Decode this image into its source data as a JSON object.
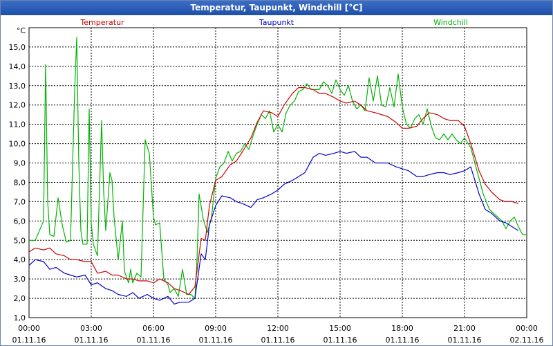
{
  "window": {
    "title": "Temperatur, Taupunkt, Windchill [°C]"
  },
  "colors": {
    "temperature": "#cc0000",
    "dewpoint": "#0000cc",
    "windchill": "#00b300",
    "titlebar": "#2a5bb8"
  },
  "chart_data": {
    "type": "line",
    "title": "Temperatur, Taupunkt, Windchill [°C]",
    "ylabel": "°C",
    "xlabel": "",
    "ylim": [
      1.0,
      16.0
    ],
    "xlim": [
      0,
      24
    ],
    "grid": true,
    "legend": "top",
    "y_ticks": [
      "1,0",
      "2,0",
      "3,0",
      "4,0",
      "5,0",
      "6,0",
      "7,0",
      "8,0",
      "9,0",
      "10,0",
      "11,0",
      "12,0",
      "13,0",
      "14,0",
      "15,0"
    ],
    "x_ticks": [
      {
        "time": "00:00",
        "date": "01.11.16"
      },
      {
        "time": "03:00",
        "date": "01.11.16"
      },
      {
        "time": "06:00",
        "date": "01.11.16"
      },
      {
        "time": "09:00",
        "date": "01.11.16"
      },
      {
        "time": "12:00",
        "date": "01.11.16"
      },
      {
        "time": "15:00",
        "date": "01.11.16"
      },
      {
        "time": "18:00",
        "date": "01.11.16"
      },
      {
        "time": "21:00",
        "date": "01.11.16"
      },
      {
        "time": "00:00",
        "date": "02.11.16"
      }
    ],
    "series": [
      {
        "name": "Temperatur",
        "color": "#cc0000",
        "points": [
          [
            0.0,
            4.4
          ],
          [
            0.3,
            4.6
          ],
          [
            0.7,
            4.5
          ],
          [
            1.0,
            4.6
          ],
          [
            1.3,
            4.3
          ],
          [
            1.7,
            4.2
          ],
          [
            2.0,
            4.0
          ],
          [
            2.3,
            4.0
          ],
          [
            2.7,
            3.9
          ],
          [
            3.0,
            3.9
          ],
          [
            3.3,
            3.3
          ],
          [
            3.7,
            3.4
          ],
          [
            4.0,
            3.2
          ],
          [
            4.3,
            3.2
          ],
          [
            4.7,
            3.0
          ],
          [
            5.0,
            3.0
          ],
          [
            5.3,
            2.9
          ],
          [
            5.7,
            2.9
          ],
          [
            6.0,
            2.8
          ],
          [
            6.3,
            3.0
          ],
          [
            6.7,
            2.8
          ],
          [
            7.0,
            2.5
          ],
          [
            7.3,
            2.4
          ],
          [
            7.7,
            2.2
          ],
          [
            8.0,
            2.6
          ],
          [
            8.3,
            5.1
          ],
          [
            8.5,
            5.0
          ],
          [
            8.7,
            6.8
          ],
          [
            9.0,
            8.1
          ],
          [
            9.3,
            8.3
          ],
          [
            9.7,
            8.9
          ],
          [
            10.0,
            9.1
          ],
          [
            10.3,
            9.6
          ],
          [
            10.7,
            10.3
          ],
          [
            11.0,
            11.1
          ],
          [
            11.3,
            11.7
          ],
          [
            11.7,
            11.6
          ],
          [
            12.0,
            11.4
          ],
          [
            12.3,
            12.0
          ],
          [
            12.7,
            12.6
          ],
          [
            13.0,
            12.9
          ],
          [
            13.3,
            12.9
          ],
          [
            13.7,
            12.8
          ],
          [
            14.0,
            12.6
          ],
          [
            14.3,
            12.6
          ],
          [
            14.7,
            12.4
          ],
          [
            15.0,
            12.2
          ],
          [
            15.3,
            12.1
          ],
          [
            15.7,
            12.2
          ],
          [
            16.0,
            12.0
          ],
          [
            16.3,
            11.7
          ],
          [
            16.7,
            11.6
          ],
          [
            17.0,
            11.5
          ],
          [
            17.3,
            11.4
          ],
          [
            17.7,
            11.1
          ],
          [
            18.0,
            10.8
          ],
          [
            18.3,
            10.8
          ],
          [
            18.7,
            10.9
          ],
          [
            19.0,
            11.3
          ],
          [
            19.3,
            11.6
          ],
          [
            19.7,
            11.5
          ],
          [
            20.0,
            11.3
          ],
          [
            20.3,
            11.2
          ],
          [
            20.7,
            11.2
          ],
          [
            21.0,
            10.9
          ],
          [
            21.3,
            10.0
          ],
          [
            21.7,
            8.6
          ],
          [
            22.0,
            7.9
          ],
          [
            22.3,
            7.5
          ],
          [
            22.7,
            7.1
          ],
          [
            23.0,
            7.0
          ],
          [
            23.3,
            7.0
          ],
          [
            23.6,
            6.9
          ]
        ]
      },
      {
        "name": "Taupunkt",
        "color": "#0000cc",
        "points": [
          [
            0.0,
            3.7
          ],
          [
            0.3,
            4.0
          ],
          [
            0.7,
            3.9
          ],
          [
            1.0,
            3.5
          ],
          [
            1.3,
            3.6
          ],
          [
            1.7,
            3.3
          ],
          [
            2.0,
            3.2
          ],
          [
            2.3,
            3.1
          ],
          [
            2.7,
            3.2
          ],
          [
            3.0,
            2.7
          ],
          [
            3.3,
            2.8
          ],
          [
            3.7,
            2.5
          ],
          [
            4.0,
            2.4
          ],
          [
            4.3,
            2.2
          ],
          [
            4.7,
            2.1
          ],
          [
            5.0,
            2.3
          ],
          [
            5.3,
            2.0
          ],
          [
            5.7,
            2.2
          ],
          [
            6.0,
            2.0
          ],
          [
            6.3,
            1.9
          ],
          [
            6.7,
            2.1
          ],
          [
            7.0,
            1.7
          ],
          [
            7.3,
            1.8
          ],
          [
            7.7,
            1.8
          ],
          [
            8.0,
            2.0
          ],
          [
            8.3,
            4.3
          ],
          [
            8.5,
            4.0
          ],
          [
            8.7,
            5.8
          ],
          [
            9.0,
            6.8
          ],
          [
            9.3,
            7.3
          ],
          [
            9.7,
            7.2
          ],
          [
            10.0,
            7.0
          ],
          [
            10.3,
            6.9
          ],
          [
            10.7,
            6.7
          ],
          [
            11.0,
            7.1
          ],
          [
            11.3,
            7.2
          ],
          [
            11.7,
            7.4
          ],
          [
            12.0,
            7.6
          ],
          [
            12.3,
            7.9
          ],
          [
            12.7,
            8.1
          ],
          [
            13.0,
            8.3
          ],
          [
            13.3,
            8.5
          ],
          [
            13.7,
            9.3
          ],
          [
            14.0,
            9.5
          ],
          [
            14.3,
            9.4
          ],
          [
            14.7,
            9.5
          ],
          [
            15.0,
            9.6
          ],
          [
            15.3,
            9.5
          ],
          [
            15.7,
            9.6
          ],
          [
            16.0,
            9.3
          ],
          [
            16.3,
            9.3
          ],
          [
            16.7,
            9.0
          ],
          [
            17.0,
            9.0
          ],
          [
            17.3,
            9.0
          ],
          [
            17.7,
            8.8
          ],
          [
            18.0,
            8.7
          ],
          [
            18.3,
            8.6
          ],
          [
            18.7,
            8.3
          ],
          [
            19.0,
            8.3
          ],
          [
            19.3,
            8.4
          ],
          [
            19.7,
            8.5
          ],
          [
            20.0,
            8.5
          ],
          [
            20.3,
            8.4
          ],
          [
            20.7,
            8.5
          ],
          [
            21.0,
            8.6
          ],
          [
            21.3,
            8.8
          ],
          [
            21.7,
            7.4
          ],
          [
            22.0,
            6.6
          ],
          [
            22.3,
            6.4
          ],
          [
            22.7,
            6.0
          ],
          [
            23.0,
            5.9
          ],
          [
            23.3,
            5.7
          ],
          [
            23.6,
            5.5
          ]
        ]
      },
      {
        "name": "Windchill",
        "color": "#00b300",
        "points": [
          [
            0.0,
            5.0
          ],
          [
            0.3,
            5.0
          ],
          [
            0.7,
            6.0
          ],
          [
            0.8,
            14.1
          ],
          [
            0.9,
            7.0
          ],
          [
            1.0,
            5.3
          ],
          [
            1.2,
            5.2
          ],
          [
            1.4,
            7.2
          ],
          [
            1.6,
            5.8
          ],
          [
            1.8,
            4.9
          ],
          [
            2.0,
            5.0
          ],
          [
            2.2,
            12.7
          ],
          [
            2.3,
            15.5
          ],
          [
            2.4,
            9.0
          ],
          [
            2.5,
            5.5
          ],
          [
            2.6,
            4.8
          ],
          [
            2.8,
            4.8
          ],
          [
            2.9,
            11.8
          ],
          [
            3.0,
            5.9
          ],
          [
            3.1,
            4.8
          ],
          [
            3.3,
            4.2
          ],
          [
            3.5,
            11.2
          ],
          [
            3.6,
            7.5
          ],
          [
            3.7,
            5.5
          ],
          [
            3.9,
            8.5
          ],
          [
            4.0,
            8.1
          ],
          [
            4.1,
            6.2
          ],
          [
            4.3,
            4.0
          ],
          [
            4.5,
            6.0
          ],
          [
            4.6,
            3.4
          ],
          [
            4.8,
            2.8
          ],
          [
            4.9,
            3.5
          ],
          [
            5.0,
            2.8
          ],
          [
            5.2,
            3.3
          ],
          [
            5.4,
            3.1
          ],
          [
            5.6,
            10.2
          ],
          [
            5.8,
            9.5
          ],
          [
            6.0,
            6.2
          ],
          [
            6.1,
            5.8
          ],
          [
            6.3,
            5.9
          ],
          [
            6.5,
            3.0
          ],
          [
            6.7,
            2.7
          ],
          [
            6.8,
            2.3
          ],
          [
            7.0,
            2.5
          ],
          [
            7.2,
            2.1
          ],
          [
            7.4,
            3.5
          ],
          [
            7.6,
            2.2
          ],
          [
            7.8,
            2.2
          ],
          [
            8.0,
            2.0
          ],
          [
            8.1,
            4.0
          ],
          [
            8.2,
            7.4
          ],
          [
            8.4,
            6.1
          ],
          [
            8.6,
            5.4
          ],
          [
            8.8,
            6.2
          ],
          [
            9.0,
            8.2
          ],
          [
            9.2,
            8.8
          ],
          [
            9.4,
            9.0
          ],
          [
            9.6,
            9.6
          ],
          [
            9.8,
            9.1
          ],
          [
            10.0,
            9.5
          ],
          [
            10.2,
            9.6
          ],
          [
            10.4,
            10.0
          ],
          [
            10.6,
            9.7
          ],
          [
            10.8,
            10.4
          ],
          [
            11.0,
            11.0
          ],
          [
            11.2,
            11.5
          ],
          [
            11.4,
            11.3
          ],
          [
            11.6,
            11.7
          ],
          [
            11.8,
            10.6
          ],
          [
            12.0,
            11.0
          ],
          [
            12.2,
            10.6
          ],
          [
            12.4,
            11.6
          ],
          [
            12.6,
            12.0
          ],
          [
            12.8,
            12.2
          ],
          [
            13.0,
            12.7
          ],
          [
            13.2,
            12.8
          ],
          [
            13.4,
            13.1
          ],
          [
            13.6,
            12.8
          ],
          [
            13.8,
            12.8
          ],
          [
            14.0,
            12.8
          ],
          [
            14.2,
            13.2
          ],
          [
            14.4,
            13.0
          ],
          [
            14.6,
            12.6
          ],
          [
            14.8,
            13.3
          ],
          [
            15.0,
            12.8
          ],
          [
            15.2,
            12.5
          ],
          [
            15.4,
            13.0
          ],
          [
            15.6,
            12.2
          ],
          [
            15.8,
            11.8
          ],
          [
            16.0,
            12.0
          ],
          [
            16.2,
            11.7
          ],
          [
            16.4,
            13.4
          ],
          [
            16.6,
            12.2
          ],
          [
            16.8,
            13.5
          ],
          [
            17.0,
            12.0
          ],
          [
            17.2,
            11.9
          ],
          [
            17.4,
            12.9
          ],
          [
            17.6,
            11.9
          ],
          [
            17.8,
            13.6
          ],
          [
            18.0,
            11.9
          ],
          [
            18.2,
            11.0
          ],
          [
            18.4,
            10.8
          ],
          [
            18.6,
            11.3
          ],
          [
            18.8,
            11.5
          ],
          [
            19.0,
            11.0
          ],
          [
            19.2,
            11.8
          ],
          [
            19.4,
            10.9
          ],
          [
            19.6,
            10.3
          ],
          [
            19.8,
            10.2
          ],
          [
            20.0,
            10.5
          ],
          [
            20.2,
            10.2
          ],
          [
            20.4,
            10.5
          ],
          [
            20.6,
            10.2
          ],
          [
            20.8,
            10.0
          ],
          [
            21.0,
            10.3
          ],
          [
            21.3,
            9.8
          ],
          [
            21.6,
            8.6
          ],
          [
            21.9,
            7.4
          ],
          [
            22.2,
            6.6
          ],
          [
            22.5,
            6.3
          ],
          [
            22.8,
            6.0
          ],
          [
            23.0,
            5.6
          ],
          [
            23.2,
            6.0
          ],
          [
            23.4,
            6.2
          ],
          [
            23.6,
            5.7
          ],
          [
            23.8,
            5.3
          ],
          [
            24.0,
            5.3
          ]
        ]
      }
    ]
  }
}
